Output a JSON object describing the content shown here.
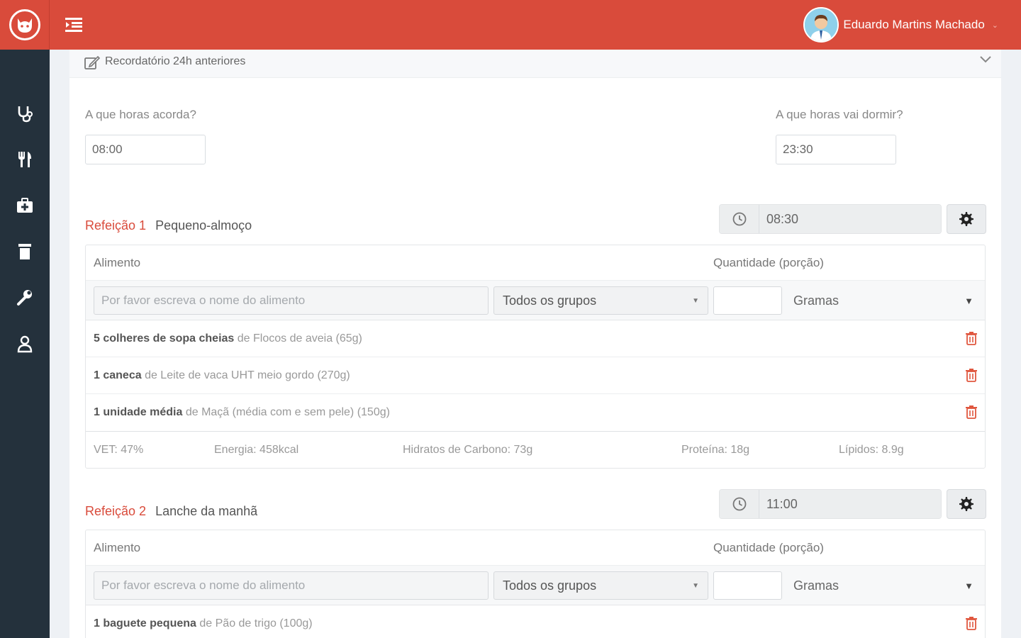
{
  "header": {
    "user_name": "Eduardo Martins Machado",
    "brand_color": "#d94b3b",
    "sidebar_color": "#24313c"
  },
  "sidebar": {
    "items": [
      {
        "icon": "stethoscope-icon"
      },
      {
        "icon": "utensils-icon"
      },
      {
        "icon": "medical-kit-icon"
      },
      {
        "icon": "clipboard-icon"
      },
      {
        "icon": "wrench-icon"
      },
      {
        "icon": "user-icon"
      }
    ]
  },
  "panel": {
    "title": "Recordatório 24h anteriores",
    "wake_label": "A que horas acorda?",
    "wake_value": "08:00",
    "sleep_label": "A que horas vai dormir?",
    "sleep_value": "23:30"
  },
  "common": {
    "col_food": "Alimento",
    "col_qty": "Quantidade (porção)",
    "food_placeholder": "Por favor escreva o nome do alimento",
    "group_select": "Todos os grupos",
    "unit_select": "Gramas"
  },
  "meals": [
    {
      "number": "Refeição 1",
      "name": "Pequeno-almoço",
      "time": "08:30",
      "foods": [
        {
          "qty": "5 colheres de sopa cheias",
          "desc": "de Flocos de aveia (65g)"
        },
        {
          "qty": "1 caneca",
          "desc": "de Leite de vaca UHT meio gordo (270g)"
        },
        {
          "qty": "1 unidade média",
          "desc": "de Maçã (média com e sem pele) (150g)"
        }
      ],
      "summary": {
        "vet": "VET: 47%",
        "energy": "Energia: 458kcal",
        "carbs": "Hidratos de Carbono: 73g",
        "protein": "Proteína: 18g",
        "lipids": "Lípidos: 8.9g"
      }
    },
    {
      "number": "Refeição 2",
      "name": "Lanche da manhã",
      "time": "11:00",
      "foods": [
        {
          "qty": "1 baguete pequena",
          "desc": "de Pão de trigo (100g)"
        }
      ]
    }
  ]
}
